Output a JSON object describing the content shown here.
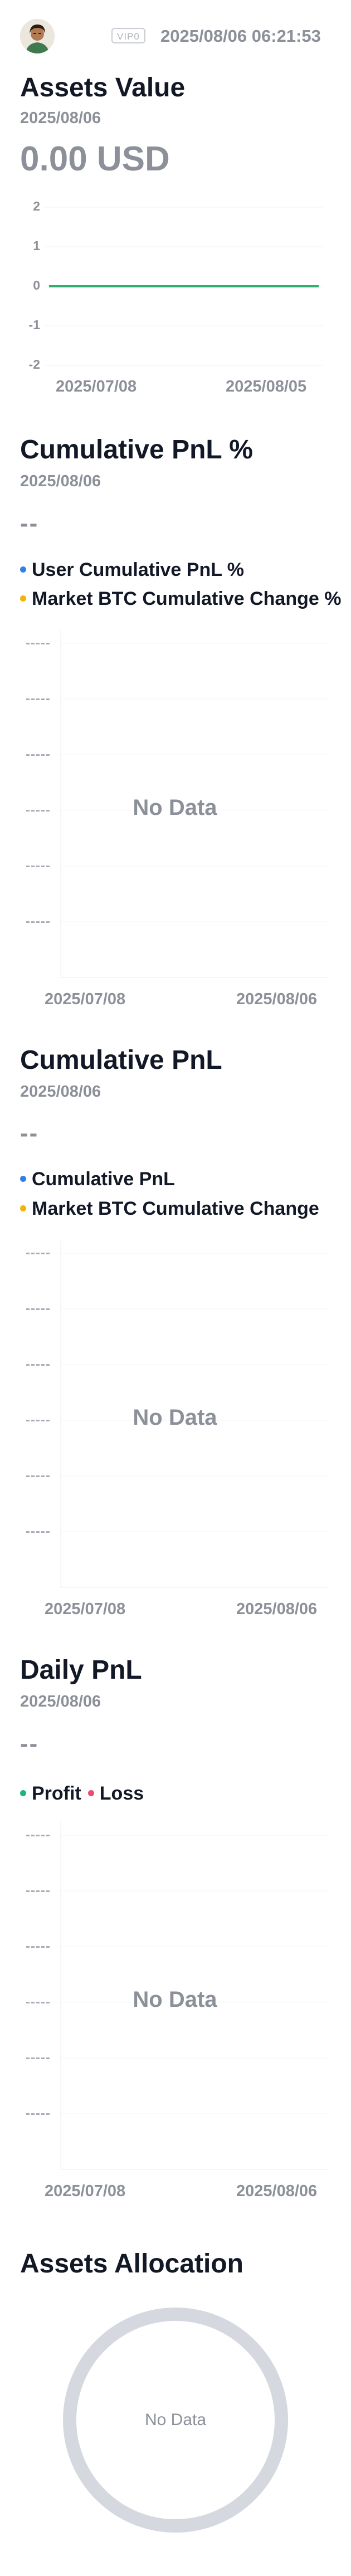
{
  "header": {
    "vip_badge": "VIP0",
    "timestamp": "2025/08/06 06:21:53",
    "avatar_icon": "user-avatar"
  },
  "assets_value": {
    "title": "Assets Value",
    "date": "2025/08/06",
    "value": "0.00 USD",
    "y_ticks": [
      "2",
      "1",
      "0",
      "-1",
      "-2"
    ],
    "x_ticks": [
      "2025/07/08",
      "2025/08/05"
    ],
    "line_color": "#2eae6f"
  },
  "cumulative_pnl_pct": {
    "title": "Cumulative PnL %",
    "date": "2025/08/06",
    "value": "--",
    "legend": [
      {
        "label": "User Cumulative PnL %",
        "color": "#2f80ed"
      },
      {
        "label": "Market BTC Cumulative Change %",
        "color": "#f5b300"
      }
    ],
    "y_tick": "-----",
    "no_data": "No Data",
    "x_ticks": [
      "2025/07/08",
      "2025/08/06"
    ]
  },
  "cumulative_pnl": {
    "title": "Cumulative PnL",
    "date": "2025/08/06",
    "value": "--",
    "legend": [
      {
        "label": "Cumulative PnL",
        "color": "#2f80ed"
      },
      {
        "label": "Market BTC Cumulative Change",
        "color": "#f5b300"
      }
    ],
    "y_tick": "-----",
    "no_data": "No Data",
    "x_ticks": [
      "2025/07/08",
      "2025/08/06"
    ]
  },
  "daily_pnl": {
    "title": "Daily PnL",
    "date": "2025/08/06",
    "value": "--",
    "legend": [
      {
        "label": "Profit",
        "color": "#1fb57a"
      },
      {
        "label": "Loss",
        "color": "#ef4b6c"
      }
    ],
    "y_tick": "-----",
    "no_data": "No Data",
    "x_ticks": [
      "2025/07/08",
      "2025/08/06"
    ]
  },
  "assets_allocation": {
    "title": "Assets Allocation",
    "no_data": "No Data",
    "ring_color": "#d5d8de"
  },
  "chart_data": [
    {
      "type": "line",
      "title": "Assets Value",
      "x": [
        "2025/07/08",
        "2025/08/05"
      ],
      "series": [
        {
          "values": [
            0,
            0
          ]
        }
      ],
      "ylim": [
        -2,
        2
      ],
      "yticks": [
        2,
        1,
        0,
        -1,
        -2
      ],
      "grid": true
    },
    {
      "type": "line",
      "title": "Cumulative PnL %",
      "x": [
        "2025/07/08",
        "2025/08/06"
      ],
      "series": [
        {
          "name": "User Cumulative PnL %",
          "values": []
        },
        {
          "name": "Market BTC Cumulative Change %",
          "values": []
        }
      ]
    },
    {
      "type": "line",
      "title": "Cumulative PnL",
      "x": [
        "2025/07/08",
        "2025/08/06"
      ],
      "series": [
        {
          "name": "Cumulative PnL",
          "values": []
        },
        {
          "name": "Market BTC Cumulative Change",
          "values": []
        }
      ]
    },
    {
      "type": "bar",
      "title": "Daily PnL",
      "x": [
        "2025/07/08",
        "2025/08/06"
      ],
      "series": [
        {
          "name": "Profit",
          "values": []
        },
        {
          "name": "Loss",
          "values": []
        }
      ]
    },
    {
      "type": "pie",
      "title": "Assets Allocation",
      "values": []
    }
  ]
}
